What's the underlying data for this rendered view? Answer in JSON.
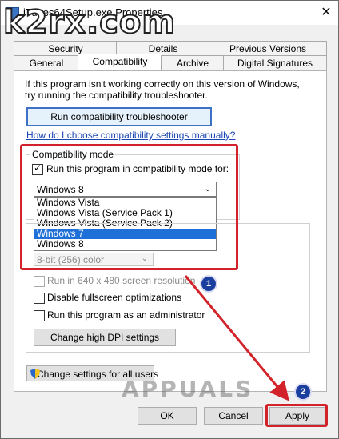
{
  "window": {
    "title": "iTunes64Setup.exe Properties",
    "close_glyph": "✕"
  },
  "watermark_top": "k2rx.com",
  "watermark_bottom": "APPUALS",
  "tabs": {
    "row1": [
      "Security",
      "Details",
      "Previous Versions"
    ],
    "row2": [
      "General",
      "Compatibility",
      "Archive",
      "Digital Signatures"
    ],
    "active": "Compatibility"
  },
  "intro": {
    "line1": "If this program isn't working correctly on this version of Windows,",
    "line2": "try running the compatibility troubleshooter."
  },
  "buttons": {
    "troubleshooter": "Run compatibility troubleshooter",
    "dpi": "Change high DPI settings",
    "all_users": "Change settings for all users",
    "ok": "OK",
    "cancel": "Cancel",
    "apply": "Apply"
  },
  "link": "How do I choose compatibility settings manually?",
  "compat_mode": {
    "group_label": "Compatibility mode",
    "checkbox_label": "Run this program in compatibility mode for:",
    "checked": true,
    "selected": "Windows 8",
    "options": [
      "Windows Vista",
      "Windows Vista (Service Pack 1)",
      "Windows Vista (Service Pack 2)",
      "Windows 7",
      "Windows 8"
    ],
    "highlighted": "Windows 7"
  },
  "settings": {
    "color_value": "8-bit (256) color",
    "options": [
      {
        "label": "Run in 640 x 480 screen resolution",
        "enabled": false
      },
      {
        "label": "Disable fullscreen optimizations",
        "enabled": true
      },
      {
        "label": "Run this program as an administrator",
        "enabled": true
      }
    ]
  },
  "markers": {
    "step1": "1",
    "step2": "2"
  },
  "colors": {
    "highlight_red": "#d2232a",
    "selection_blue": "#1e6fd8",
    "badge_blue": "#1b3f9e"
  }
}
